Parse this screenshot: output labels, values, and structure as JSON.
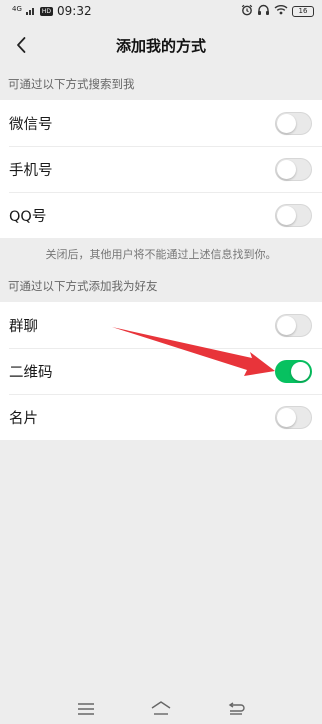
{
  "status_bar": {
    "signal": "4G",
    "hd": "HD",
    "time": "09:32",
    "battery": "16"
  },
  "nav": {
    "title": "添加我的方式"
  },
  "search_section": {
    "header": "可通过以下方式搜索到我",
    "items": [
      {
        "label": "微信号",
        "enabled": false
      },
      {
        "label": "手机号",
        "enabled": false
      },
      {
        "label": "QQ号",
        "enabled": false
      }
    ],
    "note": "关闭后，其他用户将不能通过上述信息找到你。"
  },
  "add_section": {
    "header": "可通过以下方式添加我为好友",
    "items": [
      {
        "label": "群聊",
        "enabled": false
      },
      {
        "label": "二维码",
        "enabled": true
      },
      {
        "label": "名片",
        "enabled": false
      }
    ]
  },
  "colors": {
    "toggle_on": "#07c160",
    "annotation_arrow": "#e8343a"
  }
}
